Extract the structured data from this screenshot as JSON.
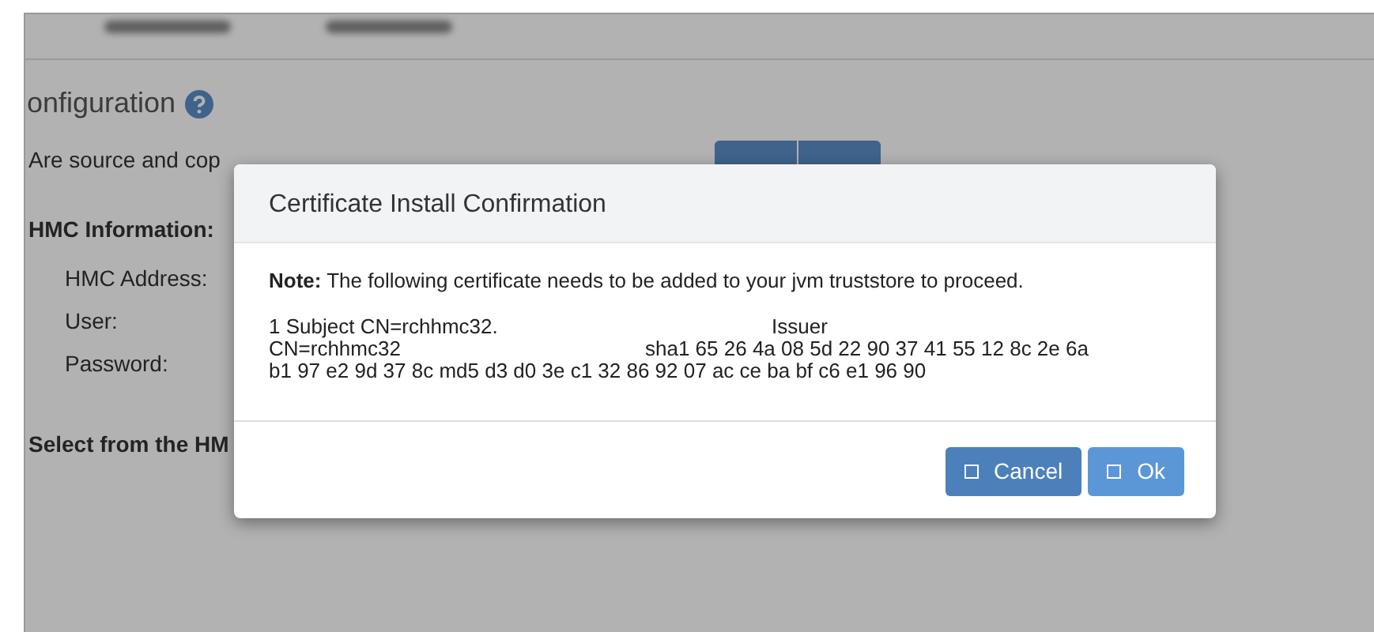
{
  "page": {
    "heading": "onfiguration",
    "question": "Are source and cop",
    "section": "HMC Information:",
    "fields": [
      {
        "label": "HMC Address:"
      },
      {
        "label": "User:"
      },
      {
        "label": "Password:"
      }
    ],
    "select_label": "Select from the HM"
  },
  "dialog": {
    "title": "Certificate Install Confirmation",
    "note_label": "Note:",
    "note": "The following certificate needs to be added to your jvm truststore to proceed.",
    "certificate": {
      "subject": "1 Subject CN=rchhmc32.",
      "issuer_label": "Issuer",
      "subject_cn": "CN=rchhmc32",
      "sha1": "sha1 65 26 4a 08 5d 22 90 37 41 55 12 8c 2e 6a",
      "md5_line": "b1 97 e2 9d 37 8c md5 d3 d0 3e c1 32 86 92 07 ac ce ba bf c6 e1 96 90"
    },
    "buttons": [
      {
        "label": "Cancel",
        "kind": "cancel"
      },
      {
        "label": "Ok",
        "kind": "ok"
      }
    ]
  }
}
